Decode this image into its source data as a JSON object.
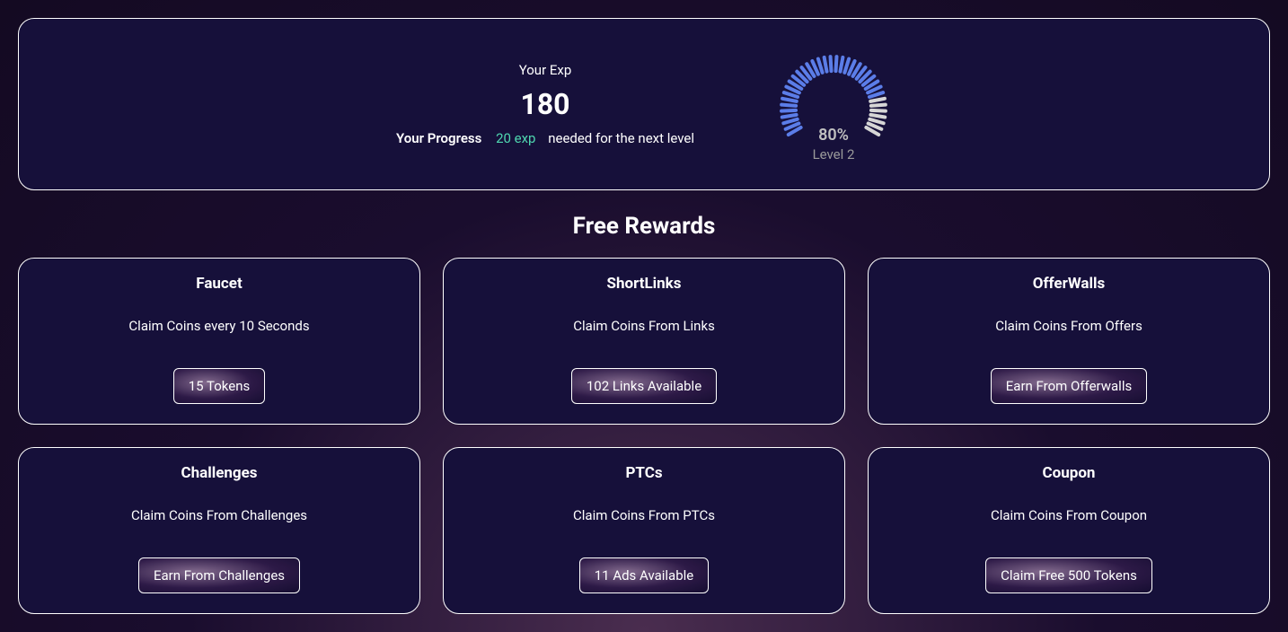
{
  "progress": {
    "label": "Your Progress",
    "exp_label": "Your Exp",
    "exp_value": "180",
    "exp_needed_amount": "20 exp",
    "exp_needed_text": "needed for the next level",
    "percent": "80%",
    "level": "Level 2",
    "gauge_percent": 80
  },
  "section_title": "Free Rewards",
  "cards": [
    {
      "title": "Faucet",
      "desc": "Claim Coins every 10 Seconds",
      "button": "15 Tokens"
    },
    {
      "title": "ShortLinks",
      "desc": "Claim Coins From Links",
      "button": "102 Links Available"
    },
    {
      "title": "OfferWalls",
      "desc": "Claim Coins From Offers",
      "button": "Earn From Offerwalls"
    },
    {
      "title": "Challenges",
      "desc": "Claim Coins From Challenges",
      "button": "Earn From Challenges"
    },
    {
      "title": "PTCs",
      "desc": "Claim Coins From PTCs",
      "button": "11 Ads Available"
    },
    {
      "title": "Coupon",
      "desc": "Claim Coins From Coupon",
      "button": "Claim Free 500 Tokens"
    }
  ]
}
